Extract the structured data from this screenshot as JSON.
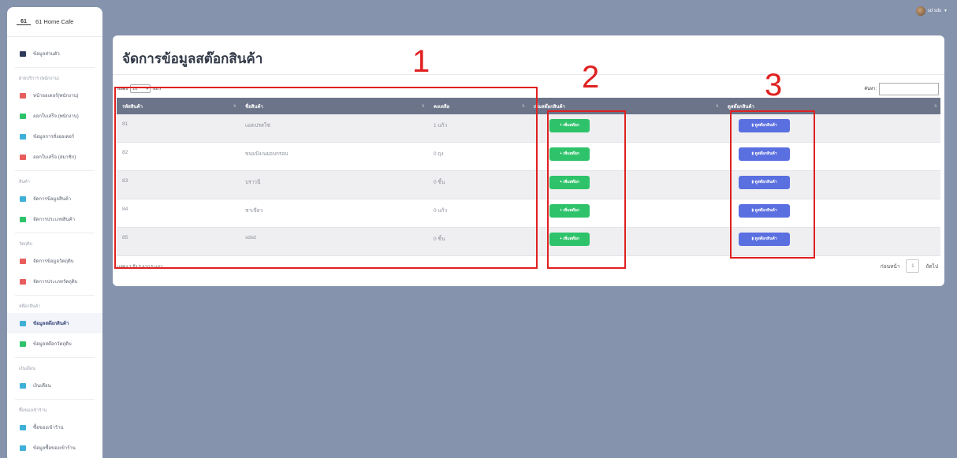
{
  "brand": {
    "logo": "61",
    "name": "61 Home Cafe"
  },
  "user": {
    "name": "sd sds"
  },
  "sidebar": {
    "top_item": {
      "label": "ข้อมูลส่วนตัว",
      "color": "#2e3a5c"
    },
    "sections": [
      {
        "title": "ฝ่ายบริการ (พนักงาน)",
        "items": [
          {
            "label": "หน้าออเดอร์(พนักงาน)",
            "color": "#e85d5d"
          },
          {
            "label": "ออกใบเสร็จ (พนักงาน)",
            "color": "#2ec36a"
          },
          {
            "label": "ข้อมูลการสั่งออเดอร์",
            "color": "#3fb0d8"
          },
          {
            "label": "ออกใบเสร็จ (สมาชิก)",
            "color": "#e85d5d"
          }
        ]
      },
      {
        "title": "สินค้า",
        "items": [
          {
            "label": "จัดการข้อมูลสินค้า",
            "color": "#3fb0d8"
          },
          {
            "label": "จัดการประเภทสินค้า",
            "color": "#2ec36a"
          }
        ]
      },
      {
        "title": "วัตถุดิบ",
        "items": [
          {
            "label": "จัดการข้อมูลวัตถุดิบ",
            "color": "#e85d5d"
          },
          {
            "label": "จัดการประเภทวัตถุดิบ",
            "color": "#e85d5d"
          }
        ]
      },
      {
        "title": "สต๊อกสินค้า",
        "items": [
          {
            "label": "ข้อมูลสต๊อกสินค้า",
            "color": "#3fb0d8",
            "active": true
          },
          {
            "label": "ข้อมูลสต๊อกวัตถุดิบ",
            "color": "#2ec36a"
          }
        ]
      },
      {
        "title": "เงินเดือน",
        "items": [
          {
            "label": "เงินเดือน",
            "color": "#3fb0d8"
          }
        ]
      },
      {
        "title": "ซื้อของเข้าร้าน",
        "items": [
          {
            "label": "ซื้อของเข้าร้าน",
            "color": "#3fb0d8"
          },
          {
            "label": "ข้อมูลซื้อของเข้าร้าน",
            "color": "#3fb0d8"
          }
        ]
      }
    ]
  },
  "page": {
    "title": "จัดการข้อมูลสต๊อกสินค้า",
    "length_label_pre": "แสดง",
    "length_value": "10",
    "length_label_post": "แถว",
    "search_label": "ค้นหา:"
  },
  "table": {
    "headers": [
      "รหัสสินค้า",
      "ชื่อสินค้า",
      "คงเหลือ",
      "เพิ่มสต๊อกสินค้า",
      "ดูสต๊อกสินค้า"
    ],
    "add_button": "+ เพิ่มสต๊อก",
    "view_button": "ดูสต๊อกสินค้า",
    "rows": [
      {
        "id": "81",
        "name": "เอสเปรสโซ่",
        "qty": "1 แก้ว"
      },
      {
        "id": "82",
        "name": "ขนมปังเนยอบกรอบ",
        "qty": "0 ถุง"
      },
      {
        "id": "83",
        "name": "บราวนี่",
        "qty": "0 ชิ้น"
      },
      {
        "id": "84",
        "name": "ชาเขียว",
        "qty": "0 แก้ว"
      },
      {
        "id": "85",
        "name": "sdsd",
        "qty": "0 ชิ้น"
      }
    ]
  },
  "footer": {
    "info": "แสดง 1 ถึง 5 จาก 5 แถว",
    "prev": "ก่อนหน้า",
    "page": "1",
    "next": "ถัดไป"
  },
  "annotations": [
    "1",
    "2",
    "3"
  ]
}
